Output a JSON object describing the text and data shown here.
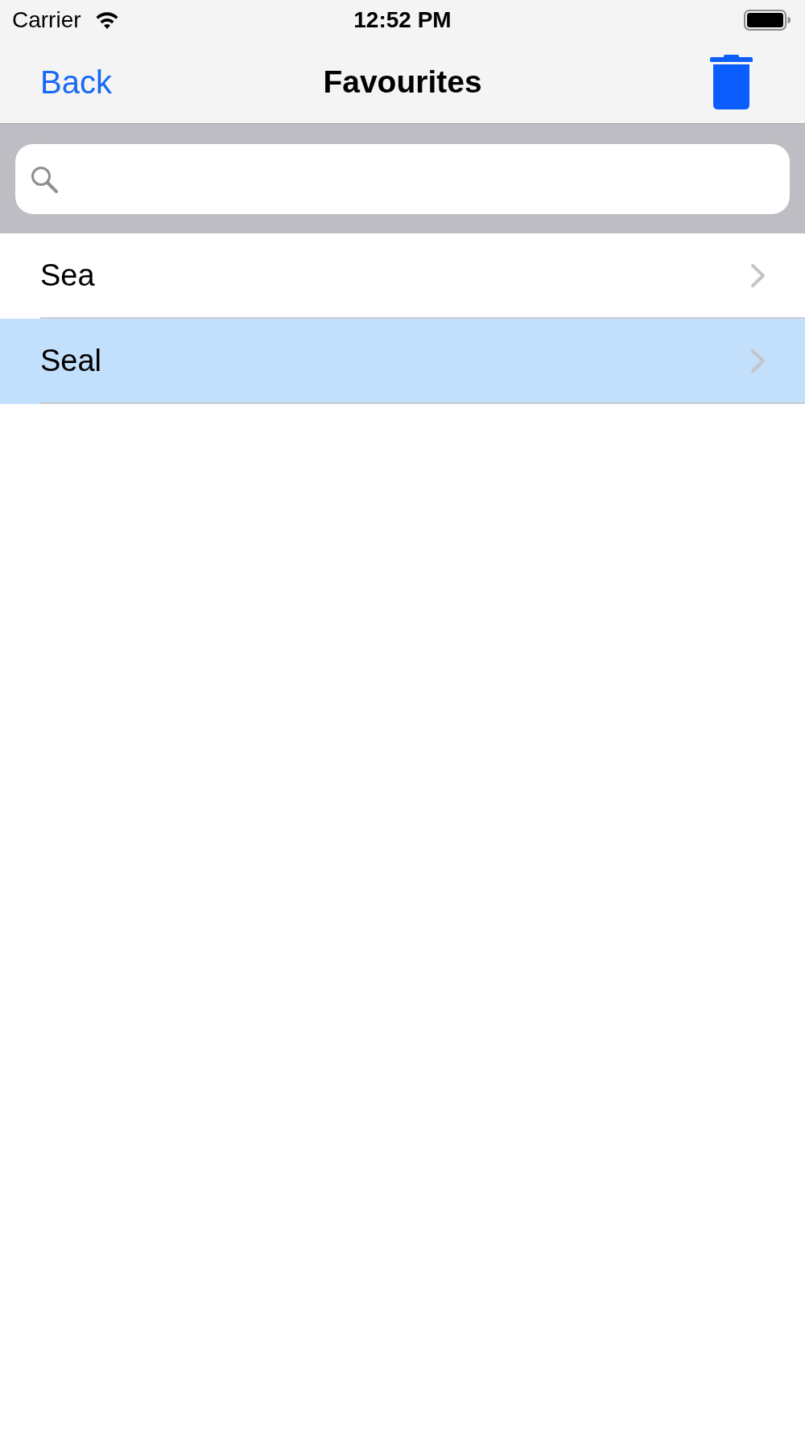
{
  "status_bar": {
    "carrier": "Carrier",
    "time": "12:52 PM"
  },
  "nav_bar": {
    "back": "Back",
    "title": "Favourites"
  },
  "rows": [
    {
      "label": "Sea",
      "selected": false
    },
    {
      "label": "Seal",
      "selected": true
    }
  ]
}
